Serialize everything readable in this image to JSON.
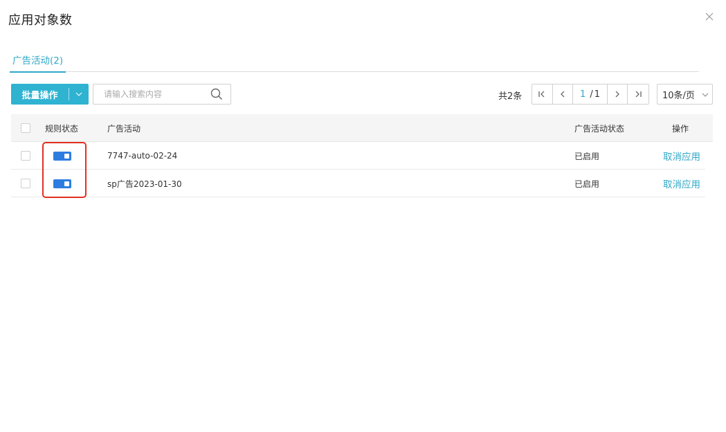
{
  "dialog": {
    "title": "应用对象数",
    "close_icon": "close-icon"
  },
  "tabs": [
    {
      "label": "广告活动(2)",
      "active": true
    }
  ],
  "toolbar": {
    "batch_label": "批量操作",
    "search_placeholder": "请输入搜索内容",
    "total_text": "共2条",
    "pagination": {
      "current": "1",
      "separator": "/",
      "total_pages": "1"
    },
    "page_size": "10条/页"
  },
  "table": {
    "headers": {
      "rule_status": "规则状态",
      "campaign": "广告活动",
      "campaign_status": "广告活动状态",
      "action": "操作"
    },
    "rows": [
      {
        "rule_enabled": true,
        "campaign": "7747-auto-02-24",
        "campaign_status": "已启用",
        "action": "取消应用"
      },
      {
        "rule_enabled": true,
        "campaign": "sp广告2023-01-30",
        "campaign_status": "已启用",
        "action": "取消应用"
      }
    ]
  },
  "colors": {
    "accent": "#2fa8c7",
    "button": "#2fb3d1",
    "toggle_on": "#2d7de0",
    "highlight": "#e2301e"
  }
}
